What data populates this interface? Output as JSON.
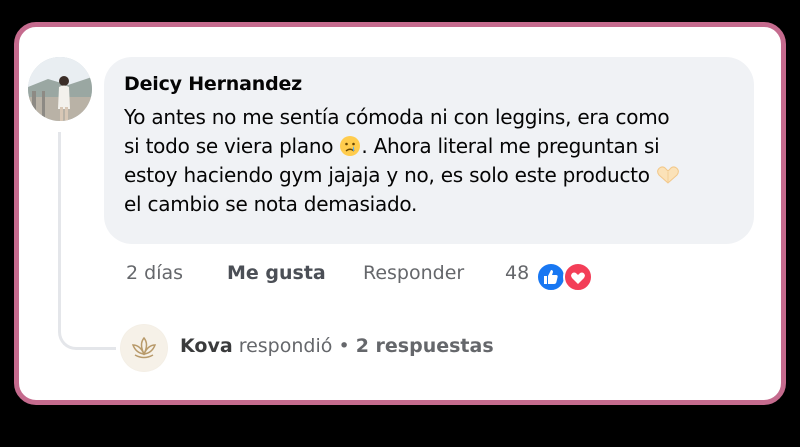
{
  "comment": {
    "author": "Deicy Hernandez",
    "text_lines": [
      "Yo antes no me sentía cómoda ni con leggins, era como",
      "si todo se viera plano",
      ". Ahora literal me preguntan si",
      "estoy haciendo gym jajaja y no, es solo este producto",
      "el cambio se nota demasiado."
    ],
    "emojis": [
      "crying-face",
      "heart-hands"
    ],
    "time": "2 días",
    "like_label": "Me gusta",
    "reply_label": "Responder",
    "reaction_count": "48",
    "reactions": [
      "like-icon",
      "love-icon"
    ],
    "colors": {
      "like": "#1877f2",
      "love": "#f33e58",
      "border": "#c56b8e"
    }
  },
  "reply_summary": {
    "name": "Kova",
    "verb": "respondió",
    "separator": "•",
    "count_label": "2 respuestas"
  }
}
